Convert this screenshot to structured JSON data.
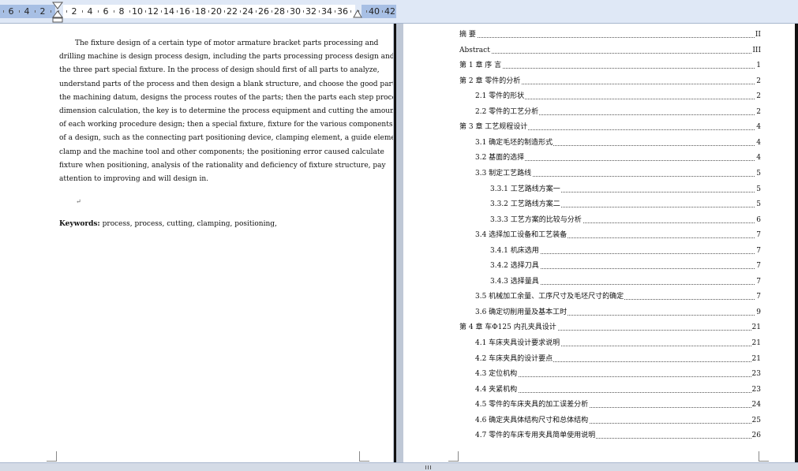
{
  "ruler": {
    "numbers": [
      "6",
      "4",
      "2",
      "2",
      "4",
      "6",
      "8",
      "10",
      "12",
      "14",
      "16",
      "18",
      "20",
      "22",
      "24",
      "26",
      "28",
      "30",
      "32",
      "34",
      "36",
      "40",
      "42"
    ]
  },
  "abstract": {
    "lines": [
      "The fixture design of a certain type of motor armature bracket parts processing and",
      "drilling machine is design process design, including the parts processing process design and",
      "the three part special fixture. In the process of design should first of all parts to analyze,",
      "understand parts of the process and then design a blank structure, and choose the good parts of",
      "the machining datum, designs the process routes of the parts; then the parts each step process",
      "dimension calculation, the key is to determine the process equipment and cutting the amount",
      "of each working procedure design; then a special fixture, fixture for the various components",
      "of a design, such as the connecting part positioning device, clamping element, a guide element,",
      "clamp and the machine tool and other components; the positioning error caused calculate",
      "fixture when positioning, analysis of the rationality and deficiency of fixture structure, pay",
      "attention to improving and will design in."
    ],
    "keywords_label": "Keywords:",
    "keywords_text": "process, process, cutting, clamping, positioning,"
  },
  "toc": [
    {
      "label": "摘    要",
      "page": "II"
    },
    {
      "label": "Abstract",
      "page": "III"
    },
    {
      "label": "第 1 章   序        言",
      "page": "1"
    },
    {
      "label": "第 2 章   零件的分析",
      "page": "2"
    },
    {
      "label": "2.1 零件的形状",
      "page": "2"
    },
    {
      "label": "2.2 零件的工艺分析",
      "page": "2"
    },
    {
      "label": "第 3 章   工艺规程设计",
      "page": "4"
    },
    {
      "label": "3.1  确定毛坯的制造形式",
      "page": "4"
    },
    {
      "label": "3.2  基面的选择",
      "page": "4"
    },
    {
      "label": "3.3  制定工艺路线",
      "page": "5"
    },
    {
      "label": "3.3.1  工艺路线方案一",
      "page": "5"
    },
    {
      "label": "3.3.2  工艺路线方案二",
      "page": "5"
    },
    {
      "label": "3.3.3  工艺方案的比较与分析",
      "page": "6"
    },
    {
      "label": "3.4  选择加工设备和工艺装备",
      "page": "7"
    },
    {
      "label": "3.4.1  机床选用",
      "page": "7"
    },
    {
      "label": "3.4.2  选择刀具",
      "page": "7"
    },
    {
      "label": "3.4.3  选择量具",
      "page": "7"
    },
    {
      "label": "3.5  机械加工余量、工序尺寸及毛坯尺寸的确定",
      "page": "7"
    },
    {
      "label": "3.6 确定切削用量及基本工时",
      "page": "9"
    },
    {
      "label": "第 4 章   车Φ125 内孔夹具设计",
      "page": "21"
    },
    {
      "label": "4.1  车床夹具设计要求说明",
      "page": "21"
    },
    {
      "label": "4.2 车床夹具的设计要点",
      "page": "21"
    },
    {
      "label": "4.3  定位机构",
      "page": "23"
    },
    {
      "label": "4.4  夹紧机构",
      "page": "23"
    },
    {
      "label": "4.5 零件的车床夹具的加工误差分析",
      "page": "24"
    },
    {
      "label": "4.6  确定夹具体结构尺寸和总体结构",
      "page": "25"
    },
    {
      "label": "4.7  零件的车床专用夹具简单使用说明",
      "page": "26"
    }
  ]
}
